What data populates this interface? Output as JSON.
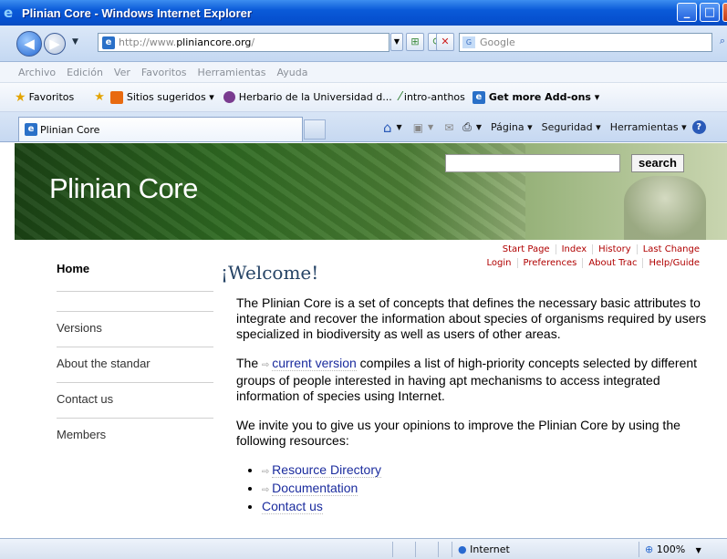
{
  "window": {
    "title": "Plinian Core - Windows Internet Explorer"
  },
  "address": {
    "url_prefix": "http://www.",
    "url_domain": "pliniancore.org",
    "url_suffix": "/",
    "search_placeholder": "Google"
  },
  "menu": [
    "Archivo",
    "Edición",
    "Ver",
    "Favoritos",
    "Herramientas",
    "Ayuda"
  ],
  "favorites": {
    "label": "Favoritos",
    "items": [
      "Sitios sugeridos ▾",
      "Herbario de la Universidad d...",
      "intro-anthos",
      "Get more Add-ons ▾"
    ]
  },
  "tab": {
    "title": "Plinian Core"
  },
  "commands": [
    "Página ▾",
    "Seguridad ▾",
    "Herramientas ▾"
  ],
  "page": {
    "logo": "Plinian Core",
    "search_button": "search",
    "metanav_top": [
      "Start Page",
      "Index",
      "History",
      "Last Change"
    ],
    "metanav_bottom": [
      "Login",
      "Preferences",
      "About Trac",
      "Help/Guide"
    ],
    "sidebar": [
      "Home",
      "Versions",
      "About the standar",
      "Contact us",
      "Members"
    ],
    "heading": "¡Welcome!",
    "p1": "The Plinian Core is a set of concepts that defines the necessary basic attributes to integrate and recover the information about species of organisms required by users specialized in biodiversity as well as users of other areas.",
    "p2_pre": "The ",
    "p2_link": "current version",
    "p2_post": " compiles a list of high-priority concepts selected by different groups of people interested in having apt mechanisms to access integrated information of species using Internet.",
    "p3": "We invite you to give us your opinions to improve the Plinian Core by using the following resources:",
    "resources": [
      "Resource Directory",
      "Documentation",
      "Contact us"
    ]
  },
  "status": {
    "zone": "Internet",
    "zoom": "100%"
  }
}
